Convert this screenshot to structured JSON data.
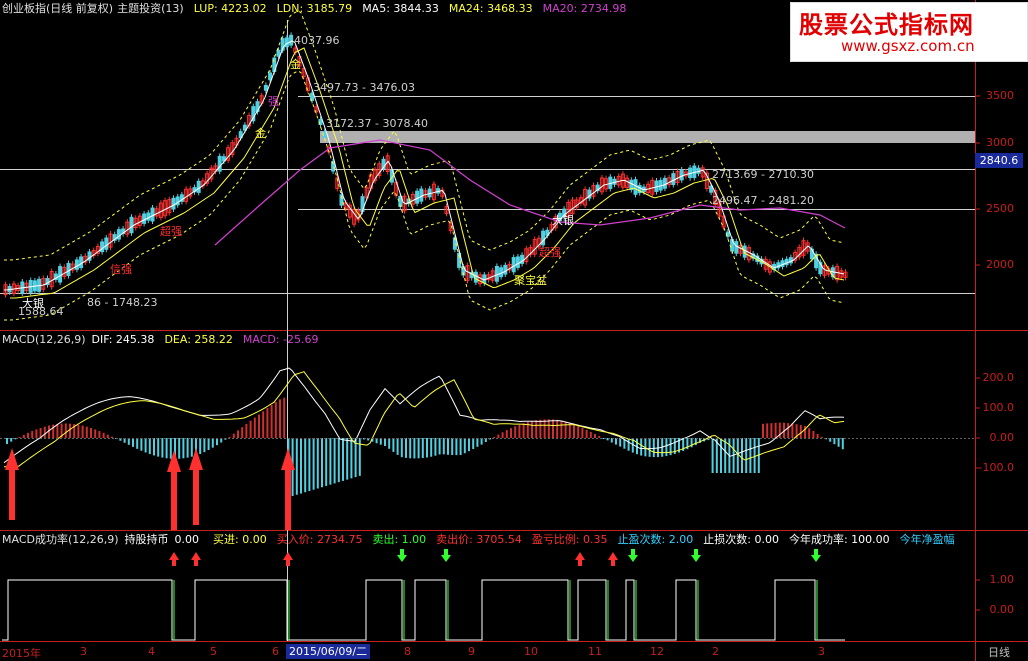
{
  "header_main": {
    "name": "创业板指",
    "period": "(日线 前复权)",
    "indicator": "主题投资(13)",
    "lup": "LUP: 4223.02",
    "ldn": "LDN: 3185.79",
    "ma5": "MA5: 3844.33",
    "ma24": "MA24: 3468.33",
    "ma20": "MA20: 2734.98"
  },
  "header_macd": {
    "name": "MACD(12,26,9)",
    "dif": "DIF: 245.38",
    "dea": "DEA: 258.22",
    "macd": "MACD: -25.69"
  },
  "header_rate": {
    "name": "MACD成功率(12,26,9)",
    "hold": "持股持币",
    "hold_val": "0.00",
    "buy": "买进: 0.00",
    "buy_price": "买入价: 2734.75",
    "sell": "卖出: 1.00",
    "sell_price": "卖出价: 3705.54",
    "pl_ratio": "盈亏比例: 0.35",
    "tp_count": "止盈次数: 2.00",
    "sl_count": "止损次数: 0.00",
    "success": "今年成功率: 100.00",
    "net": "今年净盈幅"
  },
  "watermark": {
    "title": "股票公式指标网",
    "url": "www.gsxz.com.cn"
  },
  "price_tag": "2840.6",
  "price_axis": [
    "3500",
    "3000",
    "2500",
    "2000"
  ],
  "macd_axis": [
    "200.0",
    "100.0",
    "0.00",
    "-100.0"
  ],
  "rate_axis": [
    "1.00",
    "0.00"
  ],
  "annotations": {
    "high": "4037.96",
    "r1": "3497.73 - 3476.03",
    "r2": "3172.37 - 3078.40",
    "r3": "2713.69 - 2710.30",
    "r4": "2496.47 - 2481.20",
    "low_band": "86 - 1748.23",
    "low": "1588.64",
    "jin1": "金",
    "jin2": "金",
    "qiang": "强",
    "chaoqiang": "超强",
    "chaoqiang2": "超强",
    "xinxin": "信强",
    "dayin": "大银",
    "dayin2": "大银",
    "jubaopen": "聚宝盆"
  },
  "x_axis": {
    "labels": [
      "2015年",
      "3",
      "4",
      "5",
      "6",
      "8",
      "9",
      "10",
      "11",
      "12",
      "2",
      "3"
    ],
    "selected_date": "2015/06/09/二",
    "period_label": "日线"
  },
  "colors": {
    "up": "#ff3030",
    "down": "#50d0e0",
    "ma5": "#ffffff",
    "ma24": "#ffff40",
    "ma20": "#d040d0",
    "grid": "#c81e1e"
  }
}
